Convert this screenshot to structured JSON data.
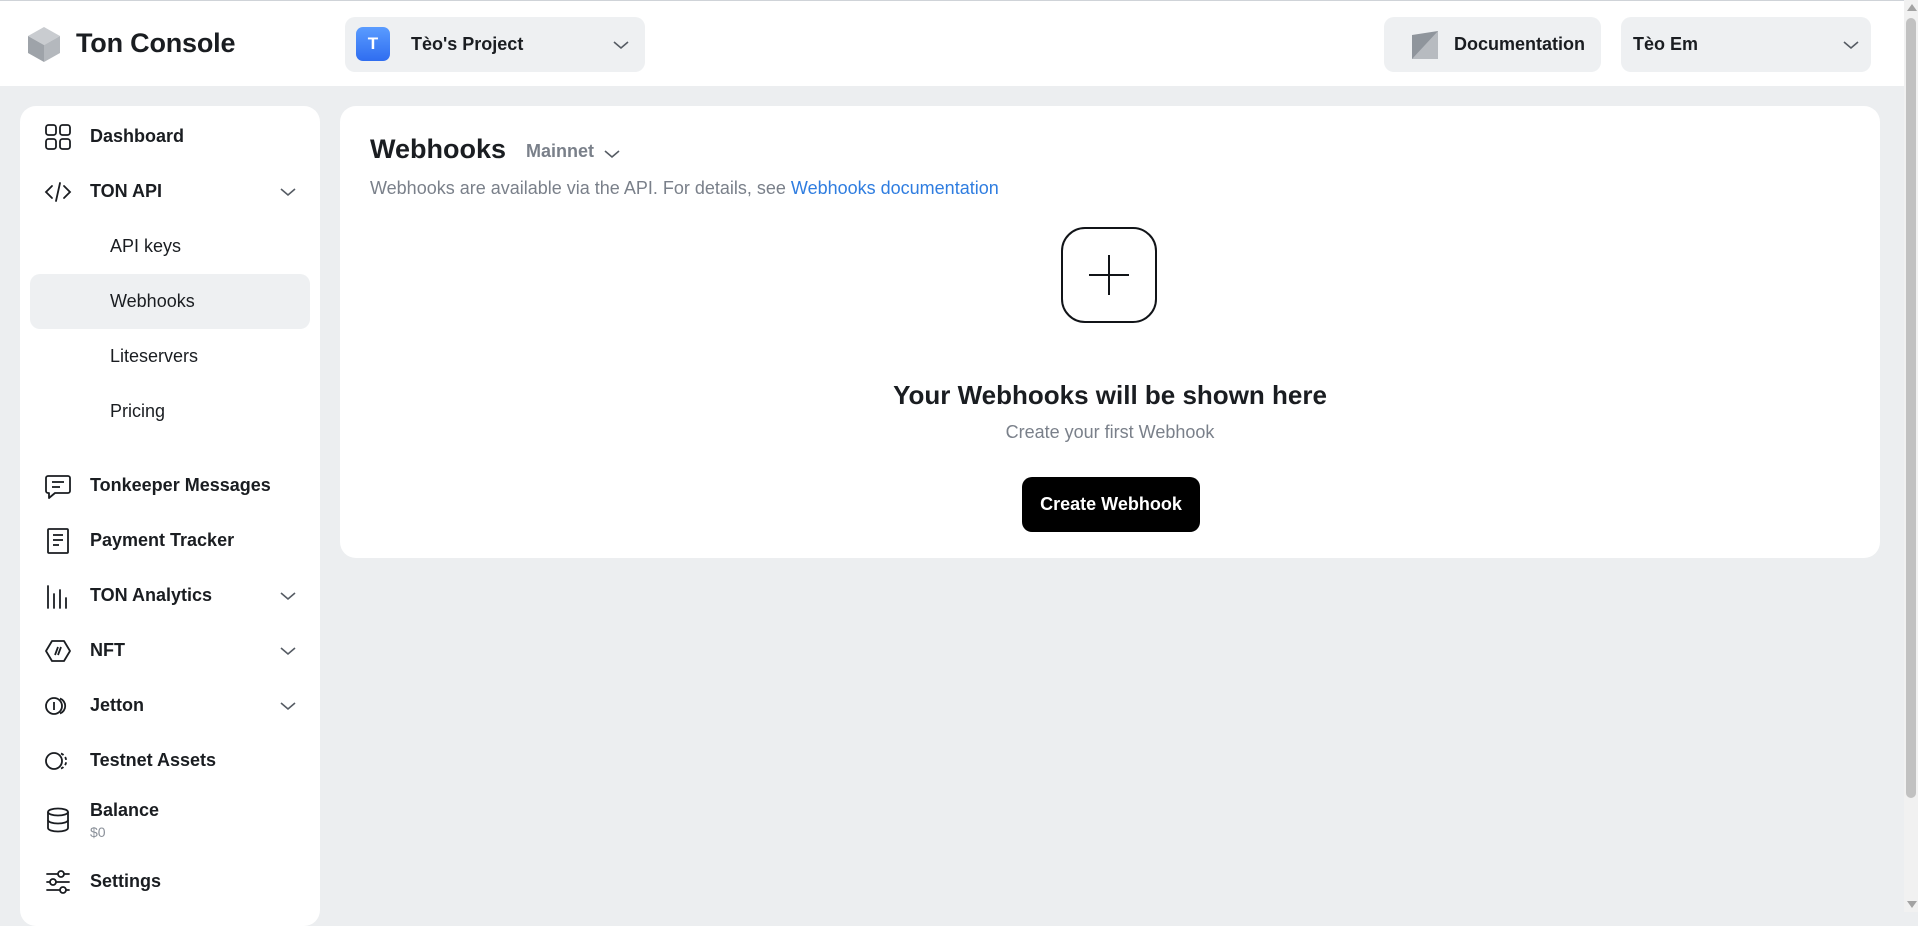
{
  "header": {
    "brand": "Ton Console",
    "project": {
      "avatar_letter": "T",
      "name": "Tèo's Project"
    },
    "documentation_label": "Documentation",
    "user_name": "Tèo Em"
  },
  "sidebar": {
    "dashboard": "Dashboard",
    "ton_api": "TON API",
    "ton_api_items": [
      "API keys",
      "Webhooks",
      "Liteservers",
      "Pricing"
    ],
    "tonkeeper_messages": "Tonkeeper Messages",
    "payment_tracker": "Payment Tracker",
    "ton_analytics": "TON Analytics",
    "nft": "NFT",
    "jetton": "Jetton",
    "testnet_assets": "Testnet Assets",
    "balance": {
      "label": "Balance",
      "value": "$0"
    },
    "settings": "Settings"
  },
  "main": {
    "title": "Webhooks",
    "network": "Mainnet",
    "description": "Webhooks are available via the API. For details, see",
    "doc_link": "Webhooks documentation",
    "empty_title": "Your Webhooks will be shown here",
    "empty_subtitle": "Create your first Webhook",
    "create_button": "Create Webhook"
  },
  "colors": {
    "background": "#eceef0",
    "accent_link": "#2f7de0",
    "avatar_blue": "#3b7bf5",
    "primary_button": "#000000"
  }
}
